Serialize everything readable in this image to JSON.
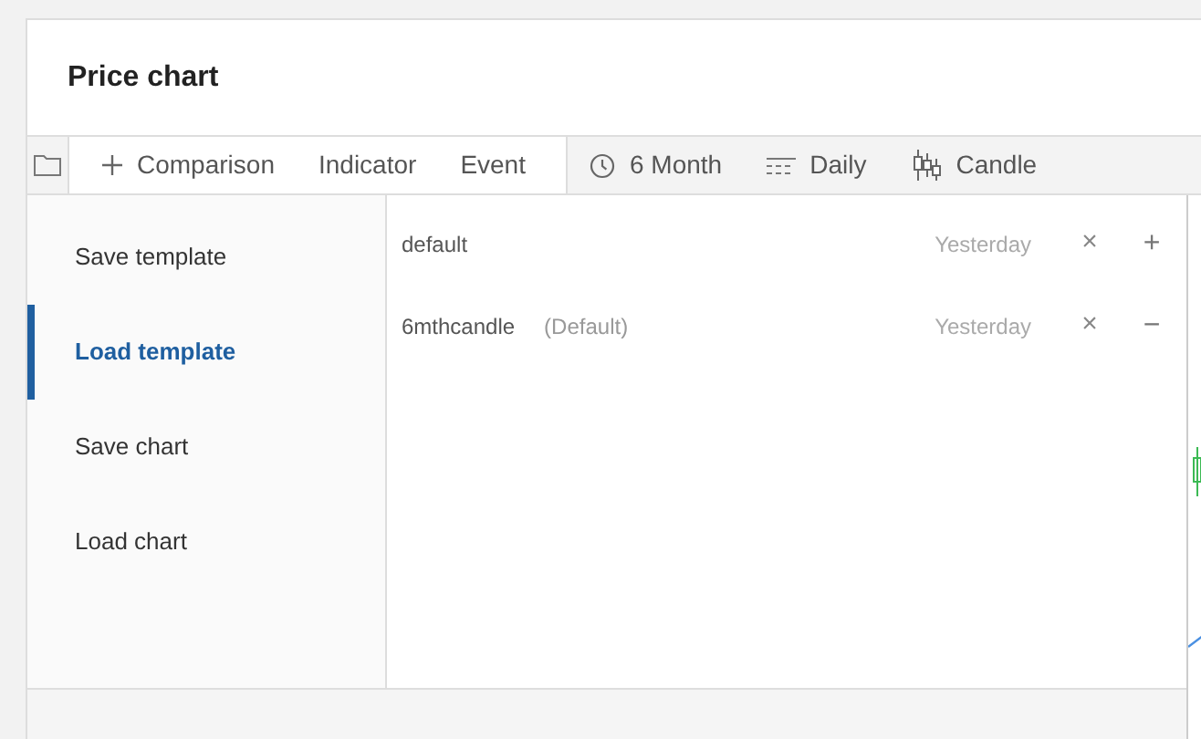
{
  "title": "Price chart",
  "toolbar": {
    "group_1": [
      {
        "label": "Comparison",
        "kind": "add"
      },
      {
        "label": "Indicator",
        "kind": "plain"
      },
      {
        "label": "Event",
        "kind": "plain"
      }
    ],
    "group_2": [
      {
        "label": "6 Month",
        "kind": "clock"
      },
      {
        "label": "Daily",
        "kind": "interval"
      },
      {
        "label": "Candle",
        "kind": "candle"
      }
    ]
  },
  "menu": [
    {
      "label": "Save template",
      "selected": false
    },
    {
      "label": "Load template",
      "selected": true
    },
    {
      "label": "Save chart",
      "selected": false
    },
    {
      "label": "Load chart",
      "selected": false
    }
  ],
  "templates": [
    {
      "name": "default",
      "time": "Yesterday",
      "delete": "×",
      "action": "+"
    },
    {
      "name": "6mthcandle",
      "tag": "(Default)",
      "time": "Yesterday",
      "delete": "×",
      "action": "−"
    }
  ]
}
